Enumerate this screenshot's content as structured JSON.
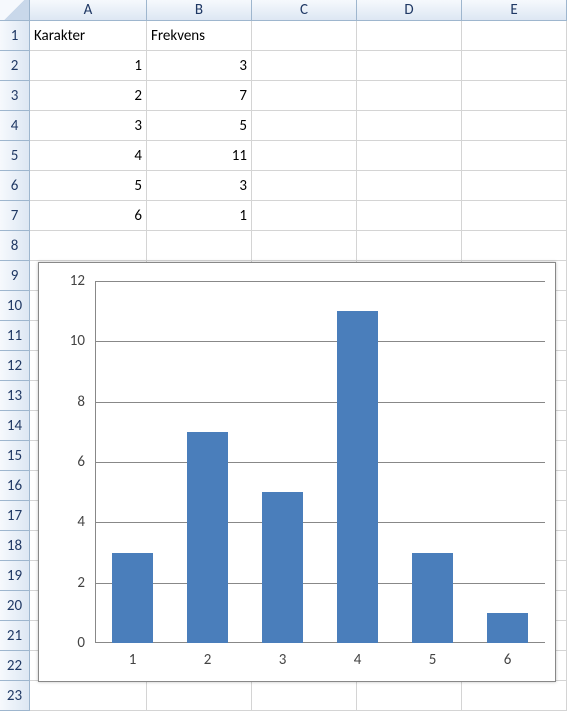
{
  "columns": [
    "A",
    "B",
    "C",
    "D",
    "E"
  ],
  "row_numbers": [
    "1",
    "2",
    "3",
    "4",
    "5",
    "6",
    "7",
    "8",
    "9",
    "10",
    "11",
    "12",
    "13",
    "14",
    "15",
    "16",
    "17",
    "18",
    "19",
    "20",
    "21",
    "22",
    "23"
  ],
  "table": {
    "headers": {
      "a": "Karakter",
      "b": "Frekvens"
    },
    "rows": [
      {
        "a": "1",
        "b": "3"
      },
      {
        "a": "2",
        "b": "7"
      },
      {
        "a": "3",
        "b": "5"
      },
      {
        "a": "4",
        "b": "11"
      },
      {
        "a": "5",
        "b": "3"
      },
      {
        "a": "6",
        "b": "1"
      }
    ]
  },
  "chart_data": {
    "type": "bar",
    "categories": [
      "1",
      "2",
      "3",
      "4",
      "5",
      "6"
    ],
    "values": [
      3,
      7,
      5,
      11,
      3,
      1
    ],
    "ylim": [
      0,
      12
    ],
    "ytick_step": 2,
    "yticks": [
      "0",
      "2",
      "4",
      "6",
      "8",
      "10",
      "12"
    ],
    "title": "",
    "xlabel": "",
    "ylabel": "",
    "bar_color": "#4a7ebb"
  }
}
